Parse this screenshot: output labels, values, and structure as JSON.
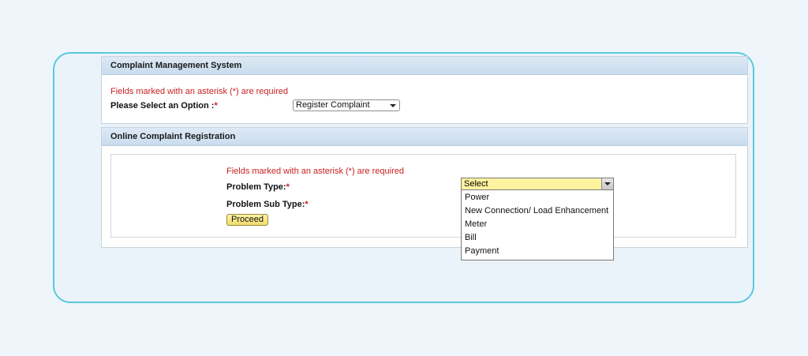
{
  "cms": {
    "title": "Complaint Management System",
    "required_note": "Fields marked with an asterisk (*) are required",
    "option_label": "Please Select an Option :",
    "option_star": "*",
    "option_value": "Register Complaint"
  },
  "registration": {
    "title": "Online Complaint Registration",
    "required_note": "Fields marked with an asterisk (*) are required",
    "problem_type_label": "Problem Type:",
    "problem_type_star": "*",
    "problem_sub_type_label": "Problem Sub Type:",
    "problem_sub_type_star": "*",
    "proceed_label": "Proceed",
    "dropdown": {
      "selected": "Select",
      "options": [
        "Power",
        "New Connection/ Load Enhancement",
        "Meter",
        "Bill",
        "Payment"
      ]
    }
  },
  "colors": {
    "accent_border": "#5bc8dc",
    "required_text": "#cc1f1f",
    "highlight": "#fff3a0"
  }
}
